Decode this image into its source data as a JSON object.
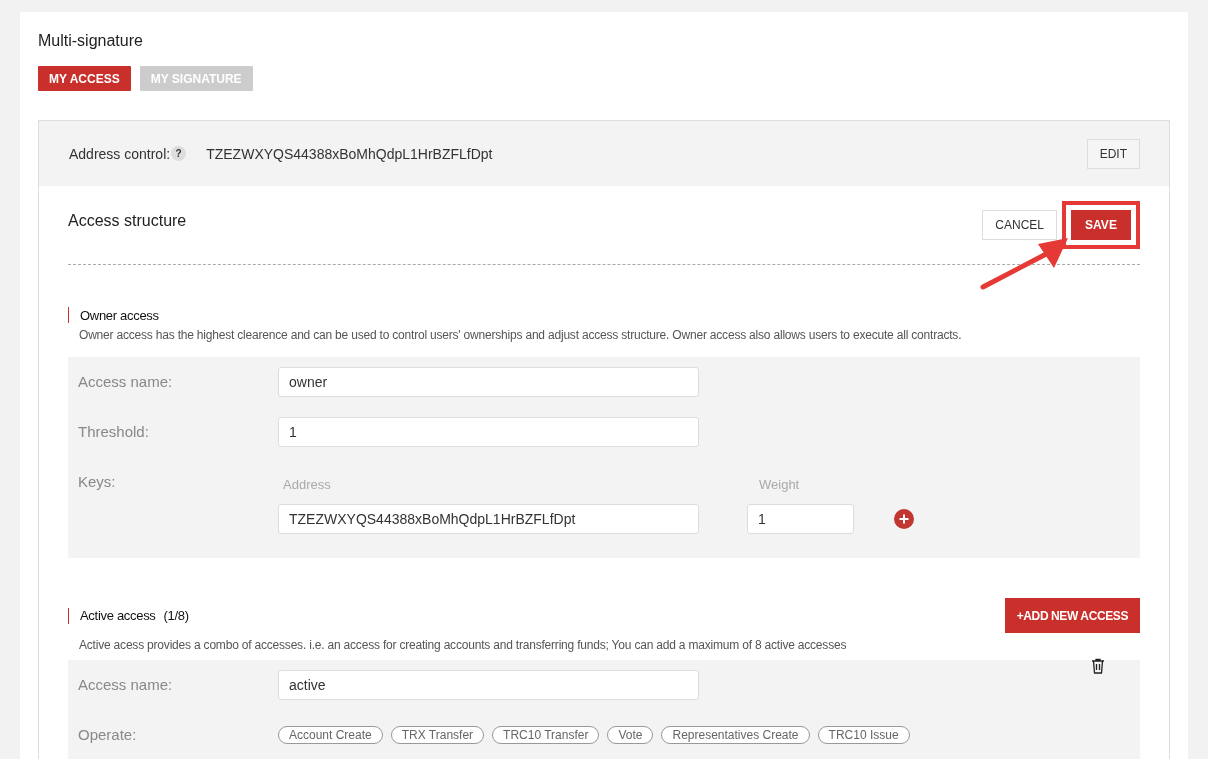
{
  "title": "Multi-signature",
  "tabs": [
    {
      "label": "MY ACCESS",
      "selected": true
    },
    {
      "label": "MY SIGNATURE",
      "selected": false
    }
  ],
  "address_control": {
    "label": "Address control:",
    "help": "?",
    "value": "TZEZWXYQS44388xBoMhQdpL1HrBZFLfDpt",
    "edit_button": "EDIT"
  },
  "access_structure": {
    "title": "Access structure",
    "cancel_button": "CANCEL",
    "save_button": "SAVE",
    "save_highlighted": true
  },
  "owner_access": {
    "title": "Owner access",
    "description": "Owner access has the highest clearence and can be used to control users' ownerships and adjust access structure. Owner access also allows users to execute all contracts.",
    "access_name_label": "Access name:",
    "access_name": "owner",
    "threshold_label": "Threshold:",
    "threshold": "1",
    "keys_label": "Keys:",
    "address_heading": "Address",
    "weight_heading": "Weight",
    "keys": [
      {
        "address": "TZEZWXYQS44388xBoMhQdpL1HrBZFLfDpt",
        "weight": "1"
      }
    ]
  },
  "active_access": {
    "title": "Active access",
    "count": "(1/8)",
    "add_button": "+ADD NEW ACCESS",
    "description": "Active acess provides a combo of accesses. i.e. an access for creating accounts and transferring funds; You can add a maximum of 8 active accesses",
    "access_name_label": "Access name:",
    "access_name": "active",
    "operate_label": "Operate:",
    "operations": [
      "Account Create",
      "TRX Transfer",
      "TRC10 Transfer",
      "Vote",
      "Representatives Create",
      "TRC10 Issue"
    ]
  }
}
